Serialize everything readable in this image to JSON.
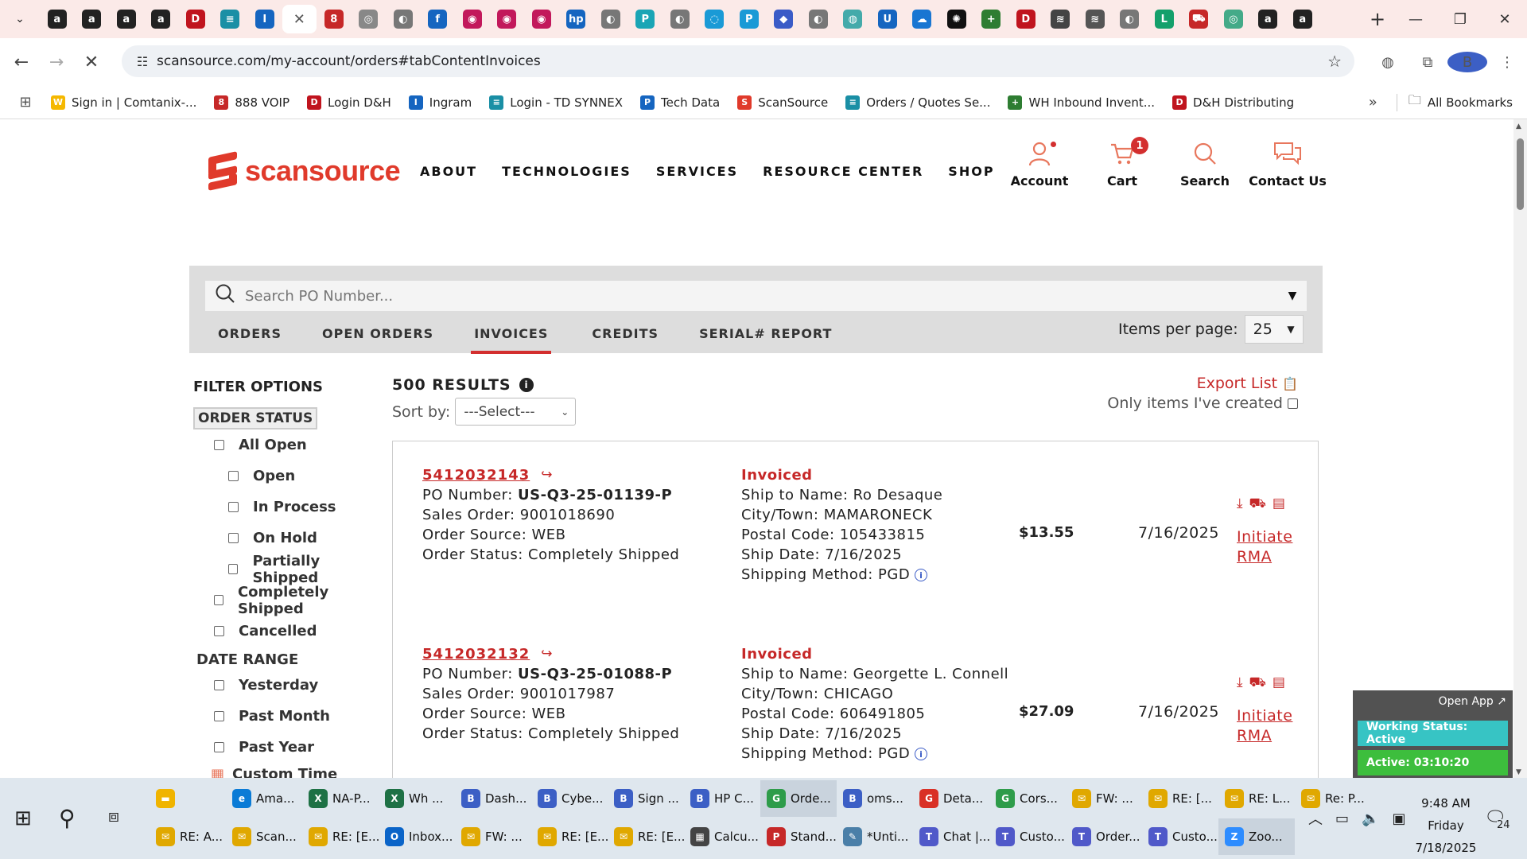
{
  "browser": {
    "tabs": [
      {
        "icon": "amazon-icon",
        "letter": "a",
        "color": "#222"
      },
      {
        "icon": "amazon-icon",
        "letter": "a",
        "color": "#222"
      },
      {
        "icon": "amazon-icon",
        "letter": "a",
        "color": "#222"
      },
      {
        "icon": "amazon-icon",
        "letter": "a",
        "color": "#222"
      },
      {
        "icon": "dh-icon",
        "letter": "D",
        "color": "#c0141e"
      },
      {
        "icon": "td-synnex-icon",
        "letter": "≡",
        "color": "#1a8fa5"
      },
      {
        "icon": "ingram-icon",
        "letter": "I",
        "color": "#1565c0"
      },
      {
        "icon": "close-icon",
        "letter": "✕",
        "color": "#555"
      },
      {
        "icon": "888-voip-icon",
        "letter": "8",
        "color": "#c62828"
      },
      {
        "icon": "generic-site-icon",
        "letter": "◎",
        "color": "#888"
      },
      {
        "icon": "globe-icon",
        "letter": "◐",
        "color": "#777"
      },
      {
        "icon": "facebook-icon",
        "letter": "f",
        "color": "#1565c0"
      },
      {
        "icon": "lg-icon",
        "letter": "◉",
        "color": "#c2185b"
      },
      {
        "icon": "lg-icon",
        "letter": "◉",
        "color": "#c2185b"
      },
      {
        "icon": "lg-icon",
        "letter": "◉",
        "color": "#c2185b"
      },
      {
        "icon": "hp-icon",
        "letter": "hp",
        "color": "#1565c0"
      },
      {
        "icon": "globe-icon",
        "letter": "◐",
        "color": "#777"
      },
      {
        "icon": "poly-icon",
        "letter": "P",
        "color": "#1aa5b5"
      },
      {
        "icon": "globe-icon",
        "letter": "◐",
        "color": "#777"
      },
      {
        "icon": "cisco-icon",
        "letter": "◌",
        "color": "#1a9ad6"
      },
      {
        "icon": "poly-icon",
        "letter": "P",
        "color": "#1a9ad6"
      },
      {
        "icon": "shield-icon",
        "letter": "◆",
        "color": "#3a5bc7"
      },
      {
        "icon": "globe-icon",
        "letter": "◐",
        "color": "#777"
      },
      {
        "icon": "generic-site-icon",
        "letter": "◍",
        "color": "#4aa"
      },
      {
        "icon": "ubiquiti-icon",
        "letter": "U",
        "color": "#1565c0"
      },
      {
        "icon": "cloud-icon",
        "letter": "☁",
        "color": "#1976d2"
      },
      {
        "icon": "openai-icon",
        "letter": "✺",
        "color": "#111"
      },
      {
        "icon": "plus-site-icon",
        "letter": "+",
        "color": "#2e7d32"
      },
      {
        "icon": "dh-icon",
        "letter": "D",
        "color": "#c0141e"
      },
      {
        "icon": "chart-site-icon",
        "letter": "≋",
        "color": "#444"
      },
      {
        "icon": "chart-site-icon",
        "letter": "≋",
        "color": "#555"
      },
      {
        "icon": "globe-icon",
        "letter": "◐",
        "color": "#777"
      },
      {
        "icon": "logi-icon",
        "letter": "L",
        "color": "#14a06b"
      },
      {
        "icon": "truck-site-icon",
        "letter": "⛟",
        "color": "#c62828"
      },
      {
        "icon": "generic-site-icon",
        "letter": "◎",
        "color": "#4a8"
      },
      {
        "icon": "amazon-icon",
        "letter": "a",
        "color": "#222"
      },
      {
        "icon": "amazon-icon",
        "letter": "a",
        "color": "#222"
      }
    ],
    "active_tab_index": 7,
    "url": "scansource.com/my-account/orders#tabContentInvoices",
    "profile_letter": "B",
    "bookmarks": [
      {
        "label": "Sign in | Comtanix-...",
        "icon": "comtanix-icon",
        "letter": "W",
        "color": "#f5b800"
      },
      {
        "label": "888 VOIP",
        "icon": "888-voip-icon",
        "letter": "8",
        "color": "#c62828"
      },
      {
        "label": "Login D&H",
        "icon": "dh-icon",
        "letter": "D",
        "color": "#c0141e"
      },
      {
        "label": "Ingram",
        "icon": "ingram-icon",
        "letter": "I",
        "color": "#1565c0"
      },
      {
        "label": "Login - TD SYNNEX",
        "icon": "td-synnex-icon",
        "letter": "≡",
        "color": "#1a8fa5"
      },
      {
        "label": "Tech Data",
        "icon": "tech-data-icon",
        "letter": "P",
        "color": "#1565c0"
      },
      {
        "label": "ScanSource",
        "icon": "scansource-icon",
        "letter": "S",
        "color": "#e03a2b"
      },
      {
        "label": "Orders / Quotes Se...",
        "icon": "td-synnex-icon",
        "letter": "≡",
        "color": "#1a8fa5"
      },
      {
        "label": "WH Inbound Invent...",
        "icon": "sheets-icon",
        "letter": "+",
        "color": "#2e7d32"
      },
      {
        "label": "D&H Distributing",
        "icon": "dh-icon",
        "letter": "D",
        "color": "#c0141e"
      }
    ],
    "all_bookmarks": "All Bookmarks"
  },
  "site": {
    "logo_text": "scansource",
    "nav": [
      "ABOUT",
      "TECHNOLOGIES",
      "SERVICES",
      "RESOURCE CENTER",
      "SHOP"
    ],
    "util": {
      "account": "Account",
      "cart": "Cart",
      "cart_count": "1",
      "search": "Search",
      "contact": "Contact Us"
    },
    "accent": "#c62828"
  },
  "orders_panel": {
    "search_placeholder": "Search PO Number...",
    "tabs": [
      "ORDERS",
      "OPEN ORDERS",
      "INVOICES",
      "CREDITS",
      "SERIAL# REPORT"
    ],
    "active_tab": "INVOICES",
    "items_per_page_label": "Items per page:",
    "items_per_page": "25"
  },
  "filters": {
    "title": "FILTER OPTIONS",
    "order_status_title": "ORDER STATUS",
    "all_open": "All Open",
    "open": "Open",
    "in_process": "In Process",
    "on_hold": "On Hold",
    "partially_shipped": "Partially Shipped",
    "completely_shipped": "Completely Shipped",
    "cancelled": "Cancelled",
    "date_range_title": "DATE RANGE",
    "yesterday": "Yesterday",
    "past_month": "Past Month",
    "past_year": "Past Year",
    "custom_time": "Custom Time"
  },
  "results": {
    "count": "500 RESULTS",
    "sort_label": "Sort by:",
    "sort_value": "---Select---",
    "export": "Export List",
    "only_mine": "Only items I've created",
    "orders": [
      {
        "number": "5412032143",
        "po_label": "PO Number: ",
        "po": "US-Q3-25-01139-P",
        "sales_order": "Sales Order: 9001018690",
        "source": "Order Source: WEB",
        "status": "Order Status: Completely Shipped",
        "invoice_status": "Invoiced",
        "ship_to": "Ship to Name: Ro Desaque",
        "city": "City/Town: MAMARONECK",
        "postal": "Postal Code: 105433815",
        "ship_date": "Ship Date: 7/16/2025",
        "ship_method": "Shipping Method: PGD",
        "amount": "$13.55",
        "date": "7/16/2025",
        "rma1": "Initiate",
        "rma2": "RMA"
      },
      {
        "number": "5412032132",
        "po_label": "PO Number: ",
        "po": "US-Q3-25-01088-P",
        "sales_order": "Sales Order: 9001017987",
        "source": "Order Source: WEB",
        "status": "Order Status: Completely Shipped",
        "invoice_status": "Invoiced",
        "ship_to": "Ship to Name: Georgette L. Connell",
        "city": "City/Town: CHICAGO",
        "postal": "Postal Code: 606491805",
        "ship_date": "Ship Date: 7/16/2025",
        "ship_method": "Shipping Method: PGD",
        "amount": "$27.09",
        "date": "7/16/2025",
        "rma1": "Initiate",
        "rma2": "RMA"
      }
    ]
  },
  "widget": {
    "open_app": "Open App ↗",
    "working_status": "Working Status: Active",
    "active_time": "Active: 03:10:20"
  },
  "taskbar": {
    "row1": [
      {
        "label": "",
        "icon": "file-explorer-icon",
        "letter": "▬",
        "color": "#f0b400"
      },
      {
        "label": "Ama...",
        "icon": "edge-icon",
        "letter": "e",
        "color": "#0a7bd6"
      },
      {
        "label": "NA-P...",
        "icon": "excel-icon",
        "letter": "X",
        "color": "#1e7145"
      },
      {
        "label": "Wh ...",
        "icon": "excel-icon",
        "letter": "X",
        "color": "#1e7145"
      },
      {
        "label": "Dash...",
        "icon": "chrome-icon",
        "letter": "B",
        "color": "#3c5fc5"
      },
      {
        "label": "Cybe...",
        "icon": "chrome-icon",
        "letter": "B",
        "color": "#3c5fc5"
      },
      {
        "label": "Sign ...",
        "icon": "chrome-icon",
        "letter": "B",
        "color": "#3c5fc5"
      },
      {
        "label": "HP C...",
        "icon": "chrome-icon",
        "letter": "B",
        "color": "#3c5fc5"
      },
      {
        "label": "Orde...",
        "icon": "chrome-icon",
        "letter": "G",
        "color": "#2e9c4a"
      },
      {
        "label": "oms...",
        "icon": "chrome-icon",
        "letter": "B",
        "color": "#3c5fc5"
      },
      {
        "label": "Deta...",
        "icon": "chrome-icon",
        "letter": "G",
        "color": "#d93025"
      },
      {
        "label": "Cors...",
        "icon": "chrome-icon",
        "letter": "G",
        "color": "#2e9c4a"
      },
      {
        "label": "FW: ...",
        "icon": "mail-icon",
        "letter": "✉",
        "color": "#e0a800"
      },
      {
        "label": "RE: [...",
        "icon": "mail-icon",
        "letter": "✉",
        "color": "#e0a800"
      },
      {
        "label": "RE: L...",
        "icon": "mail-icon",
        "letter": "✉",
        "color": "#e0a800"
      },
      {
        "label": "Re: P...",
        "icon": "mail-icon",
        "letter": "✉",
        "color": "#e0a800"
      }
    ],
    "row2": [
      {
        "label": "RE: A...",
        "icon": "mail-icon",
        "letter": "✉",
        "color": "#e0a800"
      },
      {
        "label": "Scan...",
        "icon": "mail-icon",
        "letter": "✉",
        "color": "#e0a800"
      },
      {
        "label": "RE: [E...",
        "icon": "mail-icon",
        "letter": "✉",
        "color": "#e0a800"
      },
      {
        "label": "Inbox...",
        "icon": "outlook-icon",
        "letter": "O",
        "color": "#0a64c8"
      },
      {
        "label": "FW: ...",
        "icon": "mail-icon",
        "letter": "✉",
        "color": "#e0a800"
      },
      {
        "label": "RE: [E...",
        "icon": "mail-icon",
        "letter": "✉",
        "color": "#e0a800"
      },
      {
        "label": "RE: [E...",
        "icon": "mail-icon",
        "letter": "✉",
        "color": "#e0a800"
      },
      {
        "label": "Calcu...",
        "icon": "calculator-icon",
        "letter": "▦",
        "color": "#444"
      },
      {
        "label": "Stand...",
        "icon": "pdf-icon",
        "letter": "P",
        "color": "#c62828"
      },
      {
        "label": "*Unti...",
        "icon": "notepad-icon",
        "letter": "✎",
        "color": "#4a7fa8"
      },
      {
        "label": "Chat |...",
        "icon": "teams-icon",
        "letter": "T",
        "color": "#5059c9"
      },
      {
        "label": "Custo...",
        "icon": "teams-icon",
        "letter": "T",
        "color": "#5059c9"
      },
      {
        "label": "Order...",
        "icon": "teams-icon",
        "letter": "T",
        "color": "#5059c9"
      },
      {
        "label": "Custo...",
        "icon": "teams-icon",
        "letter": "T",
        "color": "#5059c9"
      },
      {
        "label": "Zoo...",
        "icon": "zoom-icon",
        "letter": "Z",
        "color": "#2d8cff"
      }
    ],
    "active_row2_index": 14,
    "time": "9:48 AM",
    "day": "Friday",
    "date": "7/18/2025",
    "notif_count": "24"
  }
}
